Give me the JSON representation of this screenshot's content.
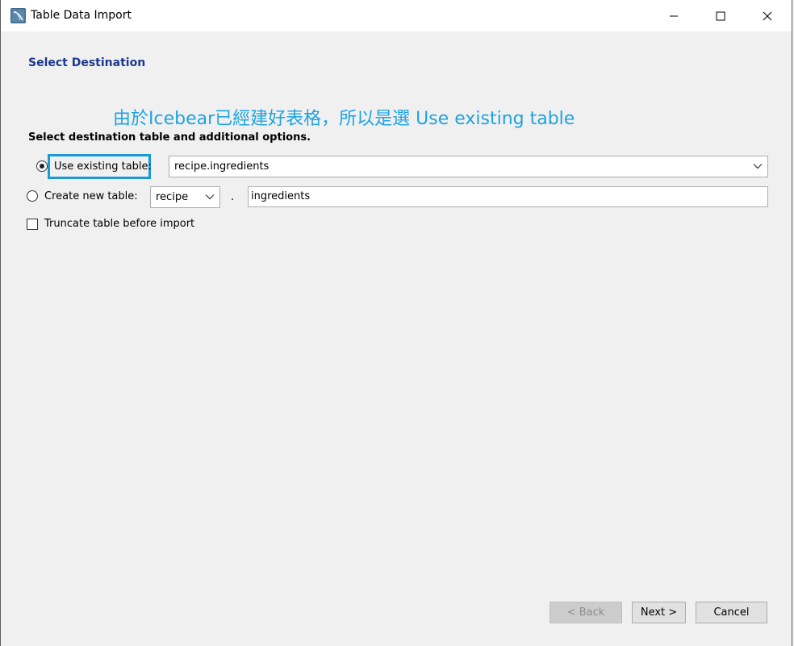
{
  "window": {
    "title": "Table Data Import",
    "controls": {
      "minimize_icon": "minimize-icon",
      "maximize_icon": "maximize-icon",
      "close_icon": "close-icon"
    }
  },
  "page": {
    "heading": "Select Destination",
    "annotation": "由於Icebear已經建好表格，所以是選 Use existing table",
    "section_label": "Select destination table and additional options."
  },
  "options": {
    "use_existing": {
      "label": "Use existing table:",
      "selected": true,
      "value": "recipe.ingredients"
    },
    "create_new": {
      "label": "Create new table:",
      "selected": false,
      "schema": "recipe",
      "dot": ".",
      "table_name": "ingredients"
    },
    "truncate": {
      "label": "Truncate table before import",
      "checked": false
    }
  },
  "buttons": {
    "back": "< Back",
    "next": "Next >",
    "cancel": "Cancel"
  },
  "colors": {
    "heading": "#1c3a8c",
    "annotation": "#1fa3e0",
    "highlight_border": "#1a9ad6",
    "background": "#f0f0f0"
  }
}
